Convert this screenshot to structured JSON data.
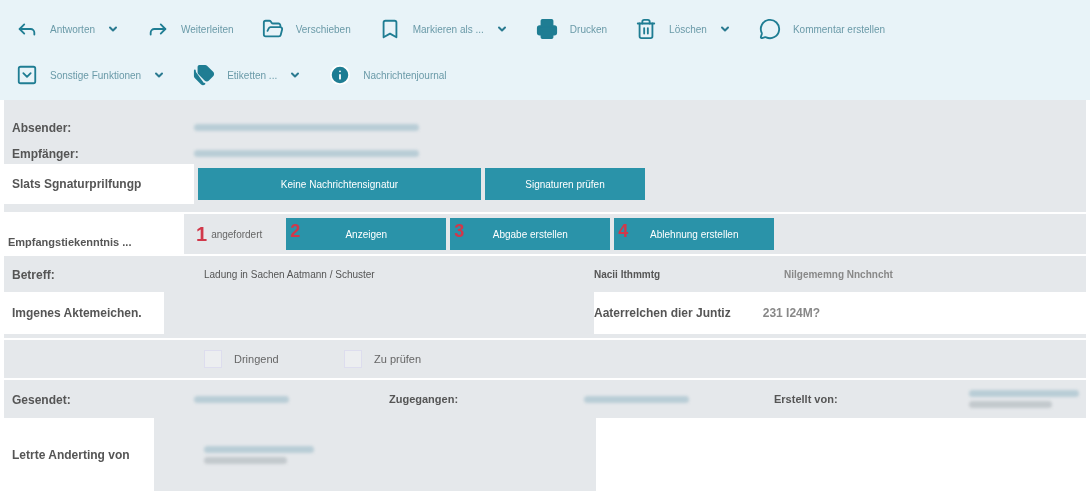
{
  "toolbar_rows": [
    [
      {
        "label": "Antworten",
        "dropdown": true
      },
      {
        "label": "Weiterleiten",
        "dropdown": false
      },
      {
        "label": "Verschieben",
        "dropdown": false
      },
      {
        "label": "Markieren als ...",
        "dropdown": true
      },
      {
        "label": "Drucken",
        "dropdown": false
      },
      {
        "label": "Löschen",
        "dropdown": true
      },
      {
        "label": "Kommentar erstellen",
        "dropdown": false
      }
    ],
    [
      {
        "label": "Sonstige Funktionen",
        "dropdown": true
      },
      {
        "label": "Etiketten ...",
        "dropdown": true
      },
      {
        "label": "Nachrichtenjournal",
        "dropdown": false
      }
    ]
  ],
  "sender": {
    "label": "Absender:"
  },
  "recipient": {
    "label": "Empfänger:"
  },
  "signature": {
    "label": "Slats Sgnaturprilfungp",
    "buttons": [
      "Keine Nachrichtensignatur",
      "Signaturen prüfen"
    ]
  },
  "receipt": {
    "label": "Empfangstiekenntnis ...",
    "status_number": "1",
    "status": "angefordert",
    "buttons": [
      {
        "number": "2",
        "label": "Anzeigen"
      },
      {
        "number": "3",
        "label": "Abgabe erstellen"
      },
      {
        "number": "4",
        "label": "Ablehnung erstellen"
      }
    ]
  },
  "subject": {
    "label": "Betreff:",
    "value": "Ladung in Sachen Aatmann / Schuster",
    "type_label": "Nacii Ithmmtg",
    "type_value": "Nilgememng Nnchncht"
  },
  "file_numbers": {
    "own_label": "Imgenes Aktemeichen.",
    "court_label": "Aaterrelchen dier Juntiz",
    "court_value": "231 I24M?"
  },
  "flags": [
    {
      "label": "Dringend",
      "checked": false
    },
    {
      "label": "Zu prüfen",
      "checked": false
    }
  ],
  "dates": {
    "sent_label": "Gesendet:",
    "received_label": "Zugegangen:",
    "created_label": "Erstellt von:"
  },
  "last_change": {
    "label": "Letrte Anderting von"
  }
}
